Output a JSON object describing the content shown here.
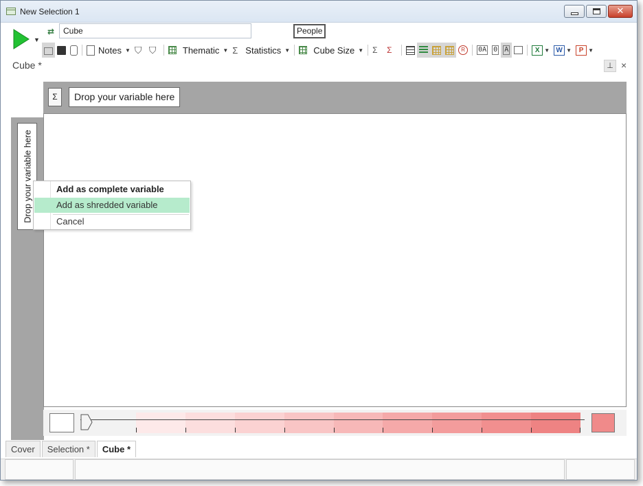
{
  "window": {
    "title": "New Selection 1",
    "controls": [
      "minimize",
      "maximize",
      "close"
    ]
  },
  "toolbar": {
    "name_value": "Cube",
    "people_label": "People",
    "notes_label": "Notes",
    "thematic_label": "Thematic",
    "statistics_label": "Statistics",
    "cube_size_label": "Cube Size",
    "sigma_glyph": "Σ",
    "oa_label": "0A",
    "o_label": "0",
    "a_label": "A"
  },
  "document": {
    "title": "Cube *"
  },
  "cube": {
    "sigma_label": "Σ",
    "drop_column_label": "Drop your variable here",
    "drop_row_label": "Drop your variable here"
  },
  "context_menu": {
    "items": [
      {
        "label": "Add as complete variable",
        "style": "bold"
      },
      {
        "label": "Add as shredded variable",
        "style": "highlighted"
      },
      {
        "label": "Cancel",
        "style": "normal"
      }
    ]
  },
  "legend": {
    "ramp_colors": [
      "#fde9e9",
      "#fcdede",
      "#fbd2d2",
      "#f9c5c5",
      "#f7b8b8",
      "#f5a9a9",
      "#f39c9c",
      "#f18f8f",
      "#ee8383"
    ],
    "low_color": "#ffffff",
    "high_color": "#f08a8a"
  },
  "tabs": [
    {
      "label": "Cover",
      "active": false
    },
    {
      "label": "Selection *",
      "active": false
    },
    {
      "label": "Cube *",
      "active": true
    }
  ],
  "colors": {
    "accent_green": "#2ea043",
    "highlight": "#b6ebcc",
    "drop_zone_gray": "#a5a5a5"
  }
}
